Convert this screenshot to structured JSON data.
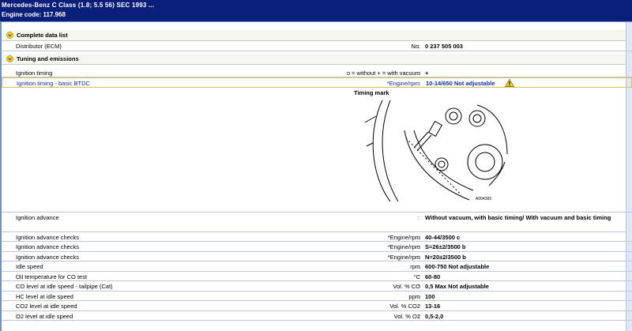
{
  "titlebar": {
    "line1": "Mercedes-Benz  C Class (1.8; 5.5 56) SEC 1993 ...",
    "line2": "Engine code: 117.968"
  },
  "sections": {
    "complete": "Complete data list",
    "tuning": "Tuning and emissions"
  },
  "distributor": {
    "label": "Distributor (ECM)",
    "unit": "No.",
    "value": "0 237 505 003"
  },
  "ignition_timing": {
    "label": "Ignition timing",
    "unit": "o = without  + = with vacuum",
    "value": "+"
  },
  "basic_timing": {
    "label": "Ignition timing - basic BTDC",
    "unit": "*Engine/rpm",
    "value": "10-14/650  Not adjustable"
  },
  "timing_mark": {
    "caption": "Timing mark",
    "figure_code": "A004383"
  },
  "advance": {
    "label": "Ignition advance",
    "value": "Without vacuum, with basic timing/ With vacuum and basic timing"
  },
  "rows": [
    {
      "label": "Ignition advance checks",
      "unit": "*Engine/rpm",
      "value": "40-44/3500 c"
    },
    {
      "label": "Ignition advance checks",
      "unit": "*Engine/rpm",
      "value": "S=26±2/3500 b"
    },
    {
      "label": "Ignition advance checks",
      "unit": "*Engine/rpm",
      "value": "N=20±2/3500 b"
    },
    {
      "label": "Idle speed",
      "unit": "rpm",
      "value": "600-750 Not adjustable"
    },
    {
      "label": "Oil temperature for CO test",
      "unit": "°C",
      "value": "60-80"
    },
    {
      "label": "CO level at idle speed - tailpipe (Cat)",
      "unit": "Vol. % CO",
      "value": "0,5 Max Not adjustable"
    },
    {
      "label": "HC level at idle speed",
      "unit": "ppm",
      "value": "100"
    },
    {
      "label": "CO2 level at idle speed",
      "unit": "Vol. % CO2",
      "value": "13-16"
    },
    {
      "label": "O2 level at idle speed",
      "unit": "Vol. % O2",
      "value": "0,5-2,0"
    }
  ],
  "colors": {
    "titlebar": "#0a1f7a",
    "link_blue": "#0b2fa8",
    "warning": "#f2d31b"
  }
}
